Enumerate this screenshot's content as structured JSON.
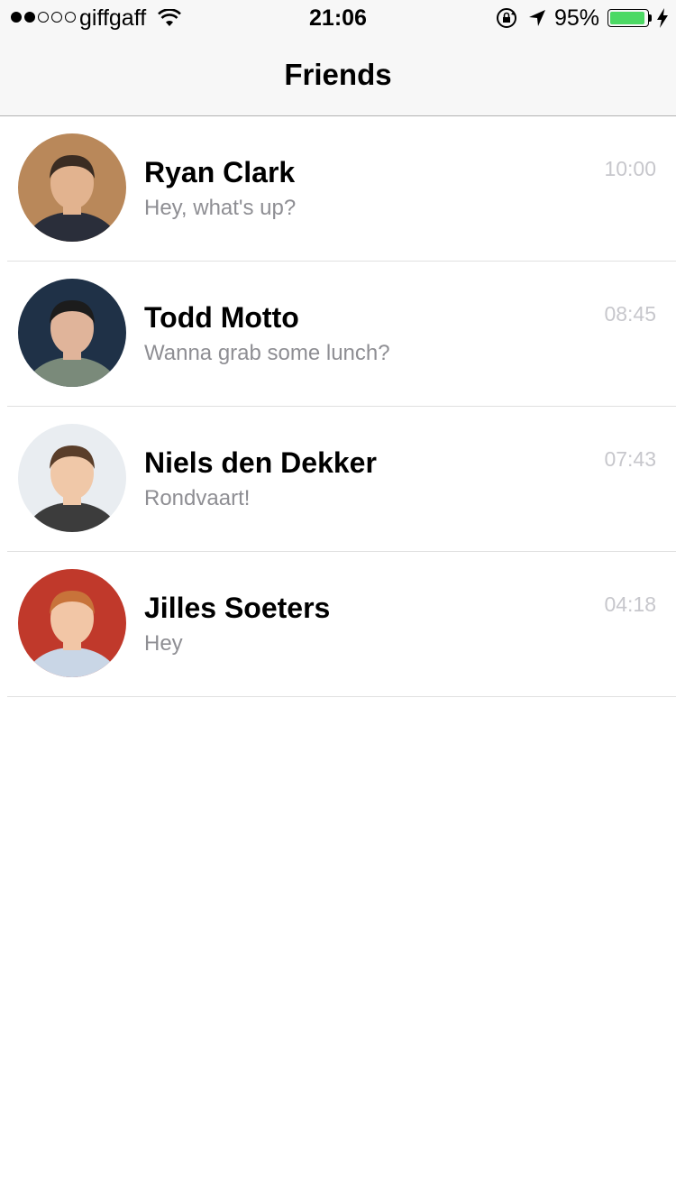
{
  "status_bar": {
    "carrier": "giffgaff",
    "signal_strength": 2,
    "signal_max": 5,
    "time": "21:06",
    "battery_percent_label": "95%",
    "battery_level": 0.95,
    "icons": [
      "wifi-icon",
      "rotation-lock-icon",
      "location-arrow-icon",
      "battery-icon",
      "charging-bolt-icon"
    ]
  },
  "nav": {
    "title": "Friends"
  },
  "friends": [
    {
      "name": "Ryan Clark",
      "message": "Hey, what's up?",
      "time": "10:00",
      "avatar_bg": "#b9885a",
      "avatar_skin": "#e2b38f",
      "avatar_hair": "#3a2c22",
      "avatar_shirt": "#2a2e3a"
    },
    {
      "name": "Todd Motto",
      "message": "Wanna grab some lunch?",
      "time": "08:45",
      "avatar_bg": "#1f3147",
      "avatar_skin": "#e0b49a",
      "avatar_hair": "#1c1c1c",
      "avatar_shirt": "#7a8a7a"
    },
    {
      "name": "Niels den Dekker",
      "message": "Rondvaart!",
      "time": "07:43",
      "avatar_bg": "#e9edf1",
      "avatar_skin": "#f0c8a8",
      "avatar_hair": "#5a3e2a",
      "avatar_shirt": "#3c3c3c"
    },
    {
      "name": "Jilles Soeters",
      "message": "Hey",
      "time": "04:18",
      "avatar_bg": "#c0392b",
      "avatar_skin": "#f2c6a6",
      "avatar_hair": "#c8733a",
      "avatar_shirt": "#c9d6e6"
    }
  ],
  "colors": {
    "battery_fill": "#4cd964",
    "secondary_text": "#8e8e93",
    "timestamp_text": "#c7c7cc"
  }
}
